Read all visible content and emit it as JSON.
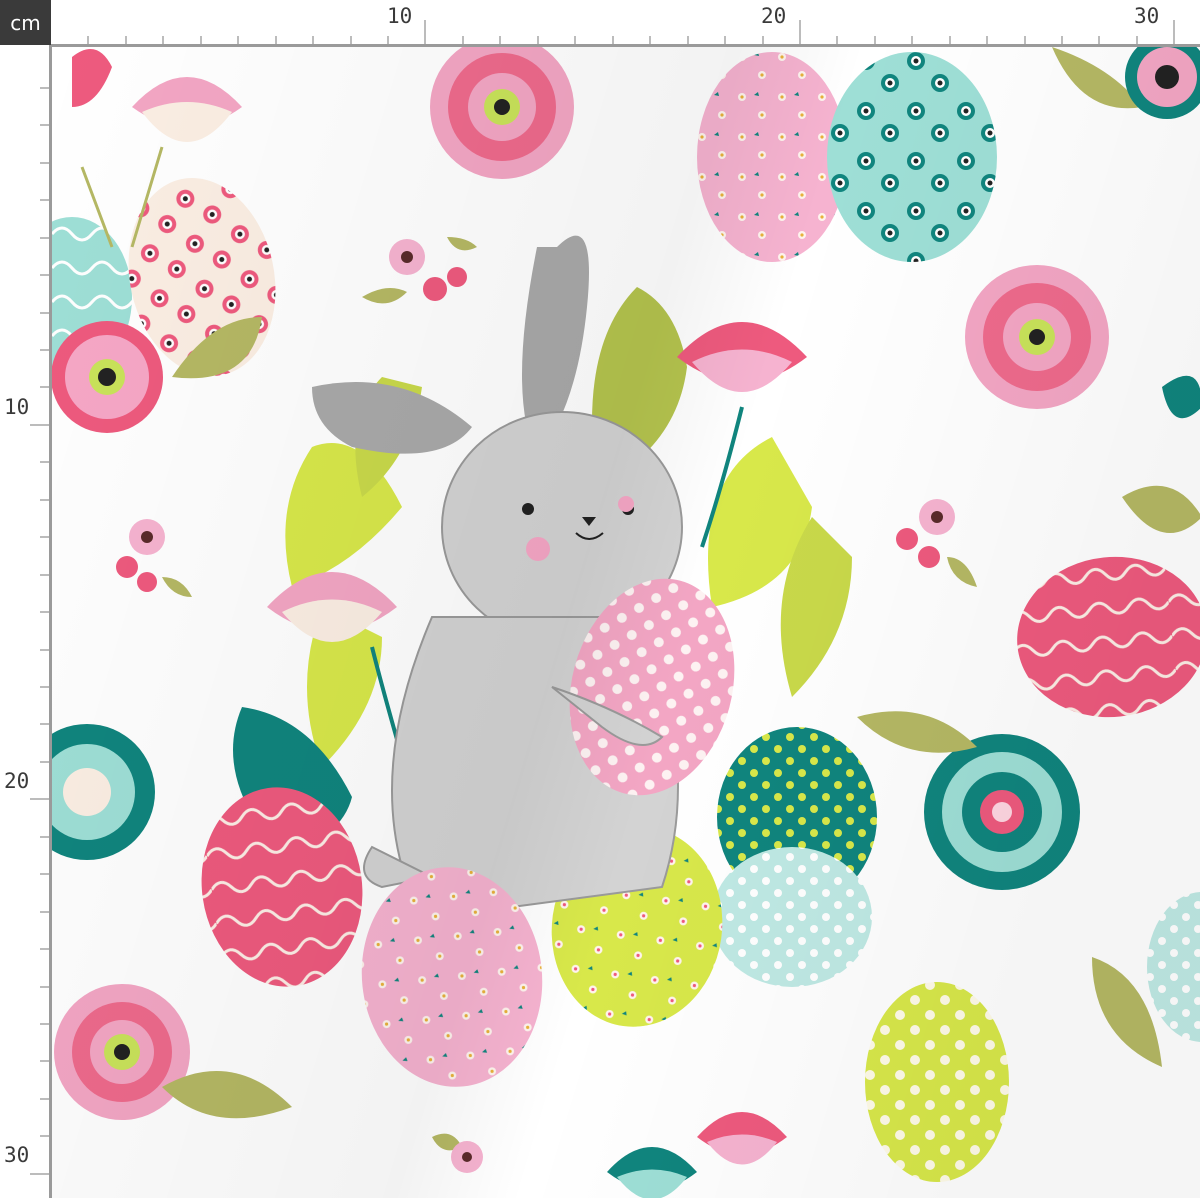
{
  "ruler": {
    "unit": "cm",
    "top_labels": [
      "10",
      "20",
      "30"
    ],
    "left_labels": [
      "10",
      "20",
      "30"
    ]
  },
  "design": {
    "subject": "bunny-hugging-egg",
    "colors": {
      "background": "#ffffff",
      "bunny": "#c9c9c9",
      "pink": "#f3a6c4",
      "coral": "#ee5a7e",
      "teal": "#10857e",
      "mint": "#9edfd6",
      "lime": "#d8e84a",
      "olive": "#b5b864",
      "cream": "#fbeee3"
    }
  }
}
